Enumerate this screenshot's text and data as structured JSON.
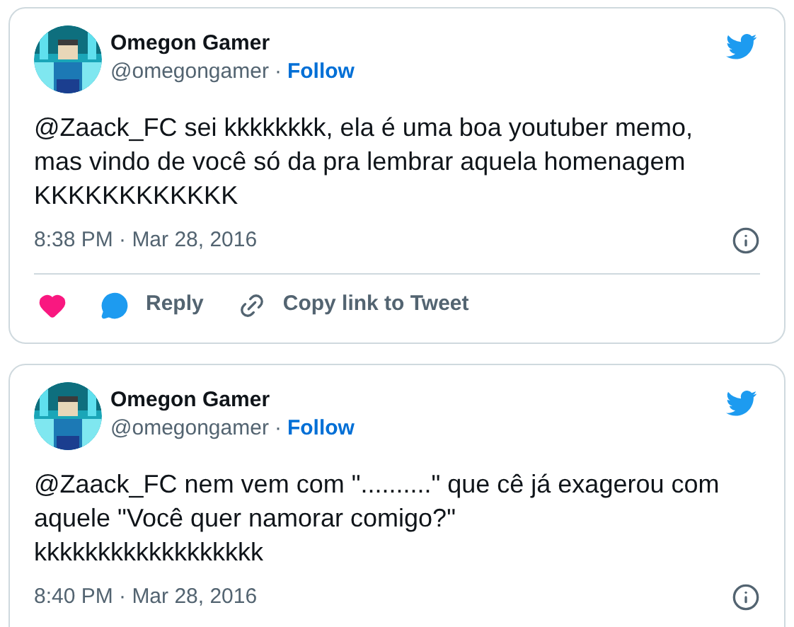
{
  "tweets": [
    {
      "author": {
        "name": "Omegon Gamer",
        "handle": "@omegongamer",
        "separator": "·",
        "follow": "Follow"
      },
      "text_lines": [
        "@Zaack_FC sei kkkkkkkk, ela é uma boa youtuber memo,",
        "mas vindo de você só da pra lembrar aquela homenagem",
        "KKKKKKKKKKKK"
      ],
      "timestamp": "8:38 PM · Mar 28, 2016",
      "actions": [
        {
          "kind": "like"
        },
        {
          "kind": "reply",
          "label": "Reply"
        },
        {
          "kind": "copy-link",
          "label": "Copy link to Tweet"
        }
      ]
    },
    {
      "author": {
        "name": "Omegon Gamer",
        "handle": "@omegongamer",
        "separator": "·",
        "follow": "Follow"
      },
      "text_lines": [
        "@Zaack_FC nem vem com \"..........\" que cê já exagerou com",
        "aquele \"Você quer namorar comigo?\"",
        "kkkkkkkkkkkkkkkkkk"
      ],
      "timestamp": "8:40 PM · Mar 28, 2016"
    }
  ]
}
